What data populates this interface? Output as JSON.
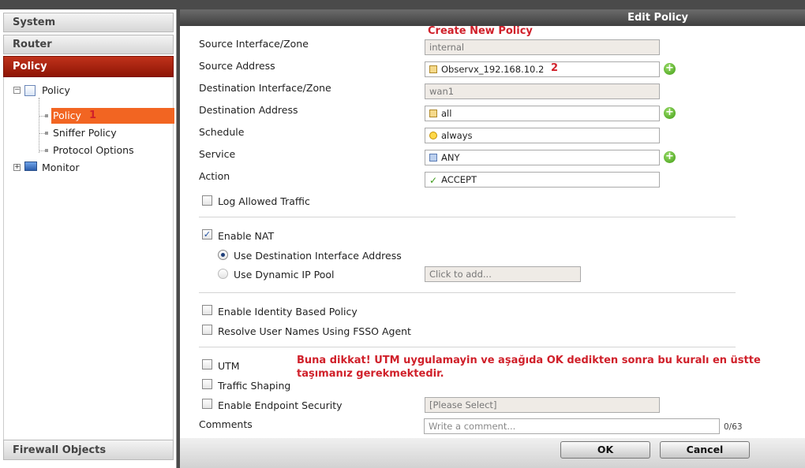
{
  "nav": {
    "system": "System",
    "router": "Router",
    "policy": "Policy",
    "firewall_objects": "Firewall Objects",
    "tree": {
      "policy_group": "Policy",
      "policy_leaf": "Policy",
      "sniffer": "Sniffer Policy",
      "protocol": "Protocol Options",
      "monitor": "Monitor"
    },
    "annot_1": "1"
  },
  "panel": {
    "title": "Edit Policy",
    "annot_create": "Create New Policy",
    "annot_2": "2",
    "annot_warning_line1": "Buna dikkat! UTM uygulamayin ve aşağıda OK dedikten sonra bu kuralı en üstte",
    "annot_warning_line2": "taşımanız gerekmektedir.",
    "fields": {
      "src_intf_label": "Source Interface/Zone",
      "src_intf_value": "internal",
      "src_addr_label": "Source Address",
      "src_addr_value": "Observx_192.168.10.2",
      "dst_intf_label": "Destination Interface/Zone",
      "dst_intf_value": "wan1",
      "dst_addr_label": "Destination Address",
      "dst_addr_value": "all",
      "schedule_label": "Schedule",
      "schedule_value": "always",
      "service_label": "Service",
      "service_value": "ANY",
      "action_label": "Action",
      "action_value": "ACCEPT"
    },
    "options": {
      "log_allowed": "Log Allowed Traffic",
      "enable_nat": "Enable NAT",
      "use_dst_intf": "Use Destination Interface Address",
      "use_dynamic_pool": "Use Dynamic IP Pool",
      "pool_placeholder": "Click to add...",
      "identity_policy": "Enable Identity Based Policy",
      "resolve_fsso": "Resolve User Names Using FSSO Agent",
      "utm": "UTM",
      "traffic_shaping": "Traffic Shaping",
      "endpoint_security": "Enable Endpoint Security",
      "endpoint_value": "[Please Select]",
      "comments_label": "Comments",
      "comments_placeholder": "Write a comment...",
      "comments_count": "0/63"
    },
    "check_mark": "✓",
    "buttons": {
      "ok": "OK",
      "cancel": "Cancel"
    }
  }
}
